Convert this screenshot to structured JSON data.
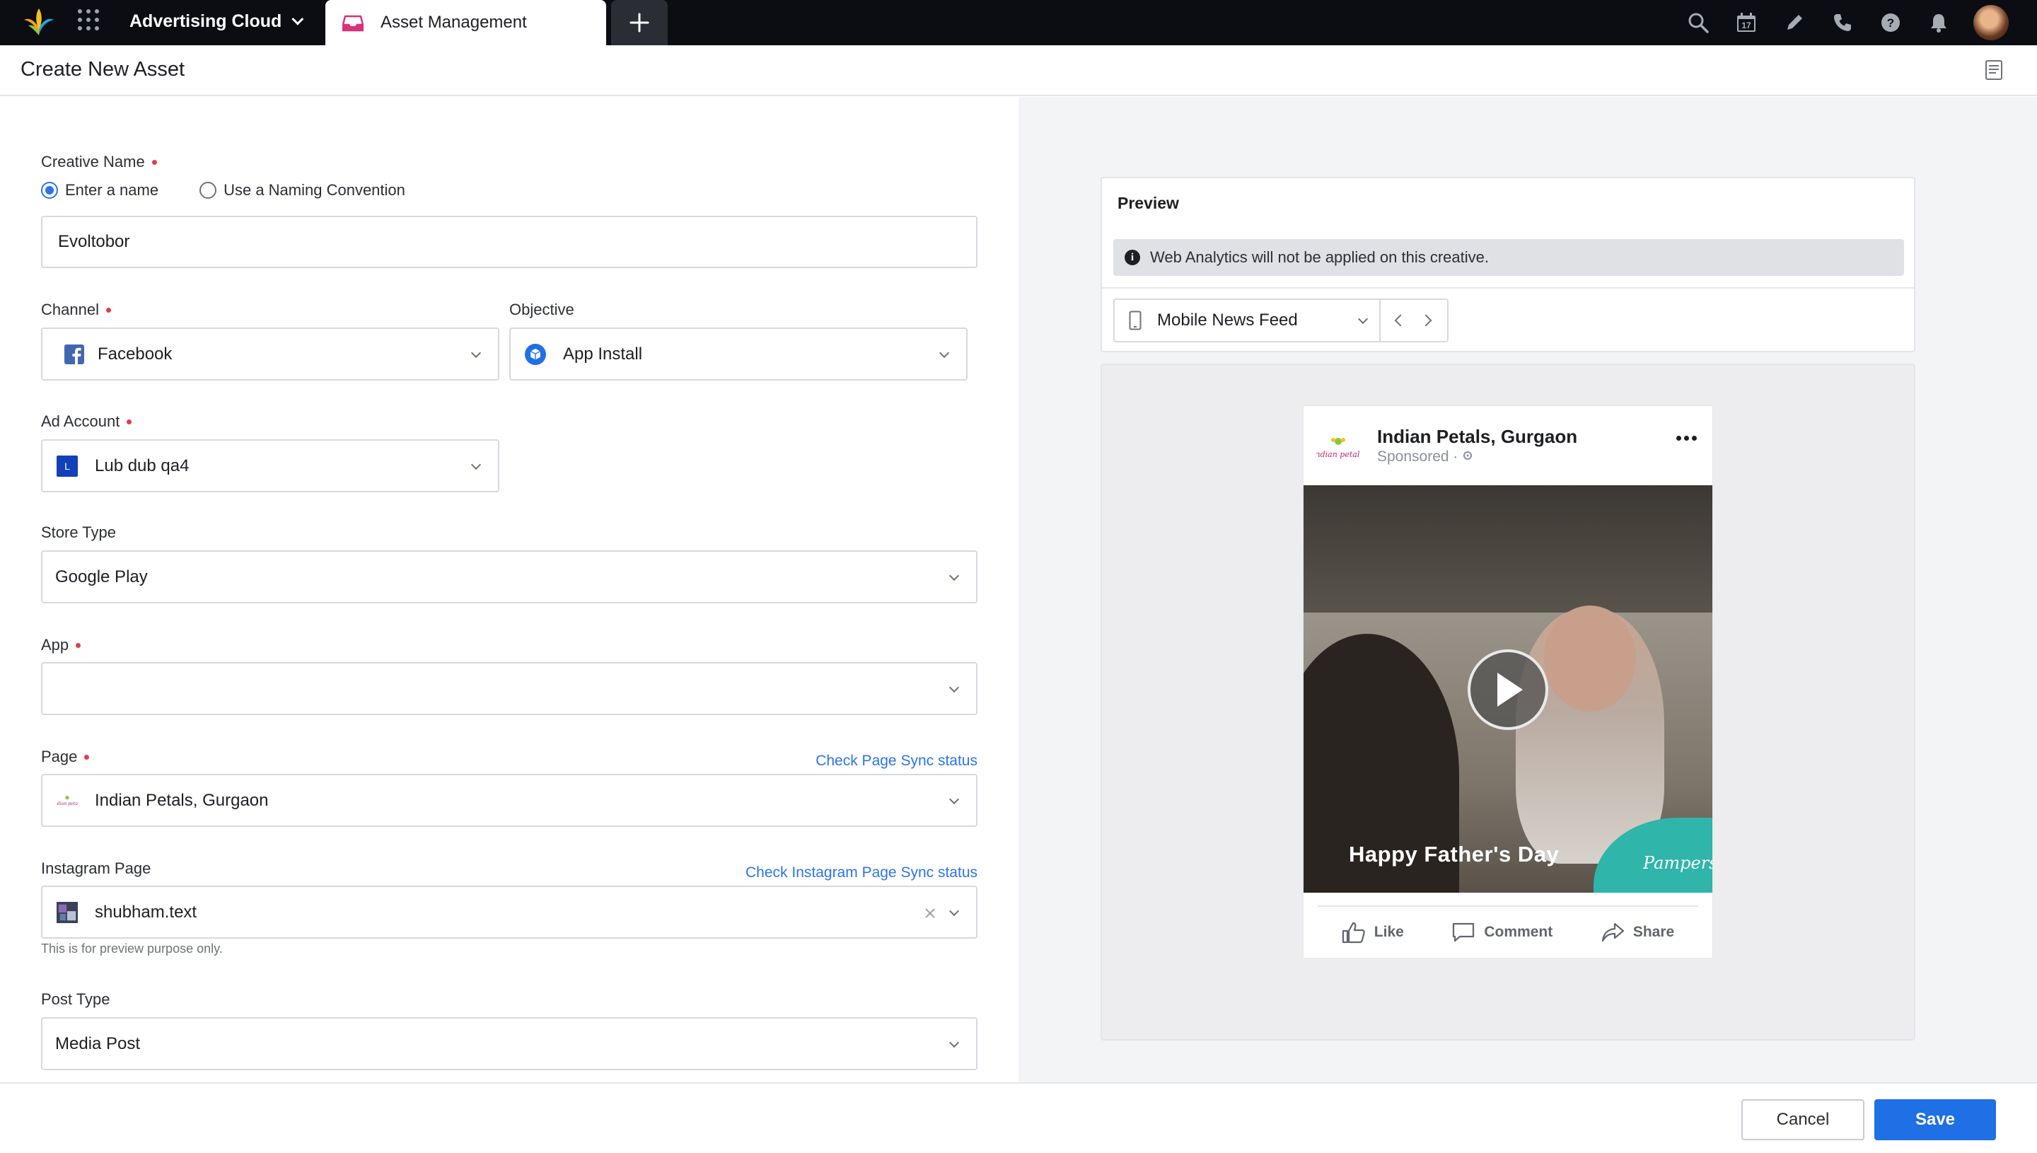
{
  "topbar": {
    "product": "Advertising Cloud",
    "active_tab": "Asset Management",
    "icons": [
      "search-icon",
      "calendar-icon",
      "pencil-icon",
      "phone-icon",
      "help-icon",
      "bell-icon"
    ],
    "calendar_day": "17"
  },
  "header": {
    "title": "Create New Asset"
  },
  "form": {
    "creative_name": {
      "label": "Creative Name",
      "options": [
        "Enter a name",
        "Use a Naming Convention"
      ],
      "selected": "Enter a name",
      "value": "Evoltobor"
    },
    "channel": {
      "label": "Channel",
      "value": "Facebook"
    },
    "objective": {
      "label": "Objective",
      "value": "App Install"
    },
    "ad_account": {
      "label": "Ad Account",
      "value": "Lub dub qa4",
      "badge": "L"
    },
    "store_type": {
      "label": "Store Type",
      "value": "Google Play"
    },
    "app": {
      "label": "App",
      "value": ""
    },
    "page": {
      "label": "Page",
      "link": "Check Page Sync status",
      "value": "Indian Petals, Gurgaon"
    },
    "instagram_page": {
      "label": "Instagram Page",
      "link": "Check Instagram Page Sync status",
      "value": "shubham.text",
      "helper": "This is for preview purpose only."
    },
    "post_type": {
      "label": "Post Type",
      "value": "Media Post"
    }
  },
  "preview": {
    "title": "Preview",
    "notice": "Web Analytics will not be applied on this creative.",
    "placement": "Mobile News Feed",
    "post": {
      "page_name": "Indian Petals, Gurgaon",
      "sponsored": "Sponsored · ",
      "avatar_brand": "indian petals",
      "caption": "Happy Father's Day",
      "watermark": "Pampers",
      "actions": [
        "Like",
        "Comment",
        "Share"
      ]
    }
  },
  "footer": {
    "cancel": "Cancel",
    "save": "Save"
  },
  "colors": {
    "accent": "#1f6fe5",
    "required": "#e23b4e",
    "link": "#2c74e8",
    "topbar": "#0b0d12"
  }
}
